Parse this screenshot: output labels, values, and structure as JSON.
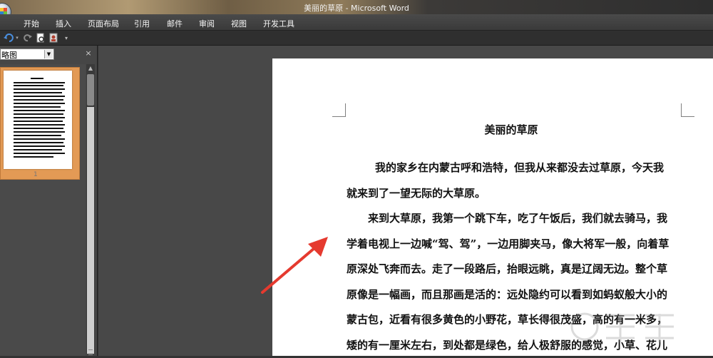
{
  "window": {
    "title": "美丽的草原 - Microsoft Word"
  },
  "ribbon": {
    "tabs": [
      "开始",
      "插入",
      "页面布局",
      "引用",
      "邮件",
      "审阅",
      "视图",
      "开发工具"
    ]
  },
  "quick_access": {
    "icons": [
      "undo-icon",
      "redo-icon",
      "print-preview-icon",
      "contact-icon",
      "customize-dropdown-icon"
    ]
  },
  "nav_pane": {
    "view_selected": "略图",
    "close_glyph": "×",
    "page_number": "1"
  },
  "document": {
    "title": "美丽的草原",
    "lines": [
      "我的家乡在内蒙古呼和浩特，但我从来都没去过草原，今天我",
      "就来到了一望无际的大草原。",
      "来到大草原，我第一个跳下车，吃了午饭后，我们就去骑马，我",
      "学着电视上一边喊“驾、驾”，一边用脚夹马，像大将军一般，向着草",
      "原深处飞奔而去。走了一段路后，抬眼远眺，真是辽阔无边。整个草",
      "原像是一幅画，而且那画是活的：远处隐约可以看到如蚂蚁般大小的",
      "蒙古包，近看有很多黄色的小野花，草长得很茂盛，高的有一米多，",
      "矮的有一厘米左右，到处都是绿色，给人极舒服的感觉，小草、花儿"
    ]
  },
  "annotation": {
    "arrow_color": "#e53a2f"
  },
  "colors": {
    "thumb_highlight": "#e39a55",
    "ribbon_bg": "#3f3f3f"
  }
}
